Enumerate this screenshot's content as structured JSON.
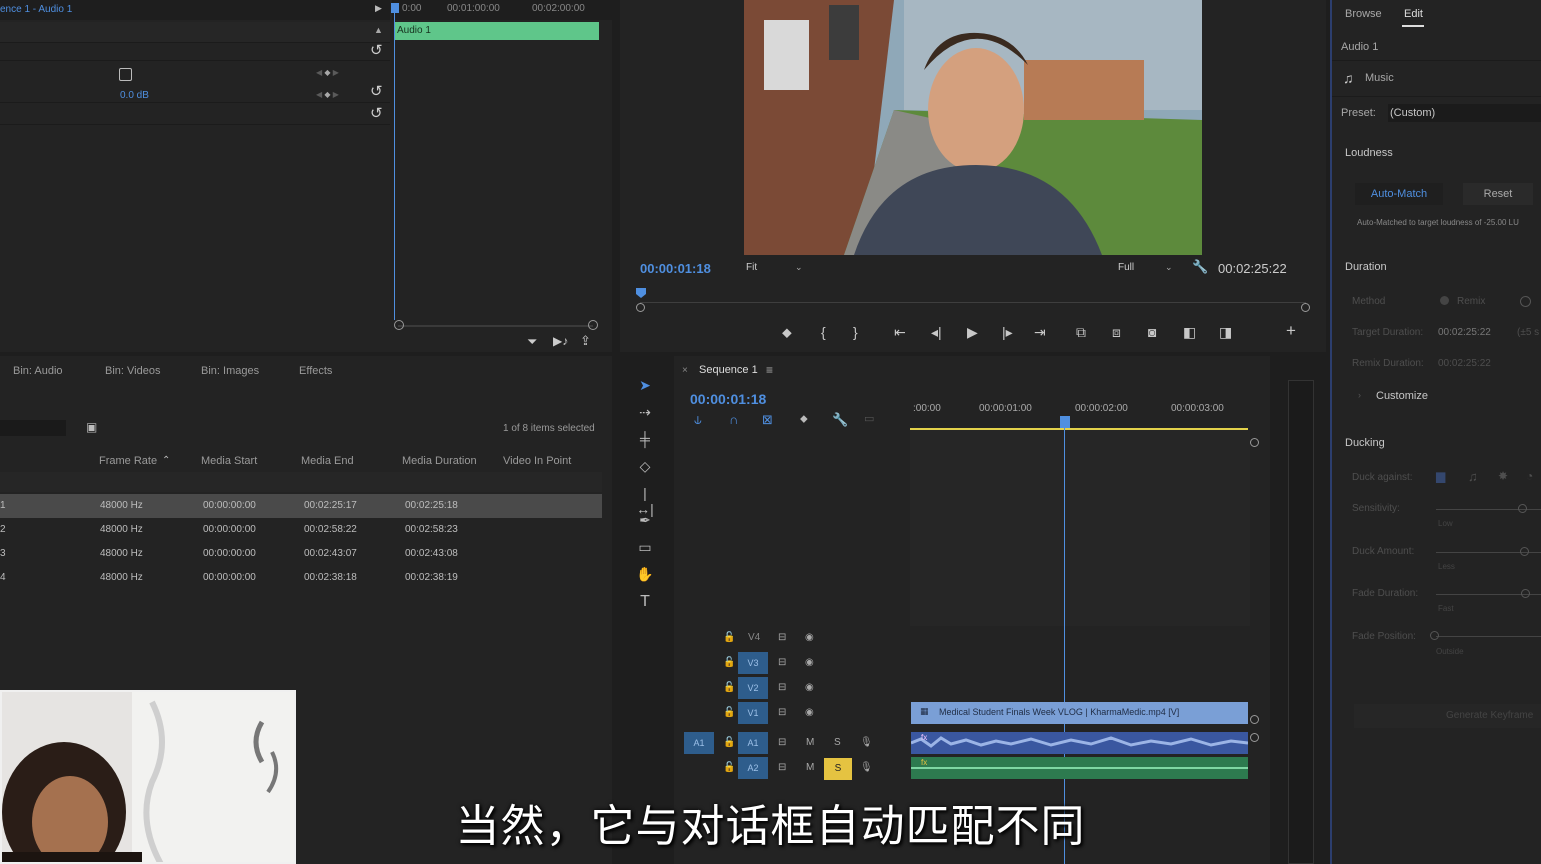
{
  "effect_controls": {
    "clip_label": "ence 1 - Audio 1",
    "ruler": [
      "0:00",
      "00:01:00:00",
      "00:02:00:00"
    ],
    "clip_name": "Audio 1",
    "level_value": "0.0 dB"
  },
  "project": {
    "tabs": [
      "Bin: Audio",
      "Bin: Videos",
      "Bin: Images",
      "Effects"
    ],
    "selection_status": "1 of 8 items selected",
    "columns": [
      "Frame Rate",
      "Media Start",
      "Media End",
      "Media Duration",
      "Video In Point"
    ],
    "rows": [
      {
        "idx": "1",
        "rate": "48000 Hz",
        "start": "00:00:00:00",
        "end": "00:02:25:17",
        "dur": "00:02:25:18"
      },
      {
        "idx": "2",
        "rate": "48000 Hz",
        "start": "00:00:00:00",
        "end": "00:02:58:22",
        "dur": "00:02:58:23"
      },
      {
        "idx": "3",
        "rate": "48000 Hz",
        "start": "00:00:00:00",
        "end": "00:02:43:07",
        "dur": "00:02:43:08"
      },
      {
        "idx": "4",
        "rate": "48000 Hz",
        "start": "00:00:00:00",
        "end": "00:02:38:18",
        "dur": "00:02:38:19"
      }
    ]
  },
  "program": {
    "timecode": "00:00:01:18",
    "fit": "Fit",
    "quality": "Full",
    "duration": "00:02:25:22",
    "playhead_fraction": 0.0
  },
  "timeline": {
    "sequence_name": "Sequence 1",
    "timecode": "00:00:01:18",
    "ruler": [
      ":00:00",
      "00:00:01:00",
      "00:00:02:00",
      "00:00:03:00"
    ],
    "video_tracks": [
      "V4",
      "V3",
      "V2",
      "V1"
    ],
    "audio_tracks": [
      "A1",
      "A2"
    ],
    "source_patch": "A1",
    "track_mute": "M",
    "track_solo": "S",
    "clip_video": "Medical Student Finals Week VLOG | KharmaMedic.mp4 [V]",
    "fx_badge": "fx"
  },
  "essential_sound": {
    "tabs": [
      "Browse",
      "Edit"
    ],
    "clip": "Audio 1",
    "type": "Music",
    "preset_label": "Preset:",
    "preset_value": "(Custom)",
    "loudness": "Loudness",
    "auto_match": "Auto-Match",
    "reset": "Reset",
    "auto_note": "Auto-Matched to target loudness of -25.00 LU",
    "duration": "Duration",
    "method_label": "Method",
    "method_value": "Remix",
    "target_label": "Target Duration:",
    "target_value": "00:02:25:22",
    "target_tol": "(±5 s",
    "remix_label": "Remix Duration:",
    "remix_value": "00:02:25:22",
    "customize": "Customize",
    "ducking": "Ducking",
    "duck_against": "Duck against:",
    "sensitivity": "Sensitivity:",
    "sens_low": "Low",
    "duck_amount": "Duck Amount:",
    "amount_less": "Less",
    "fade_duration": "Fade Duration:",
    "fade_fast": "Fast",
    "fade_position": "Fade Position:",
    "fade_outside": "Outside",
    "generate": "Generate Keyframe"
  },
  "subtitle": "当然，它与对话框自动匹配不同"
}
